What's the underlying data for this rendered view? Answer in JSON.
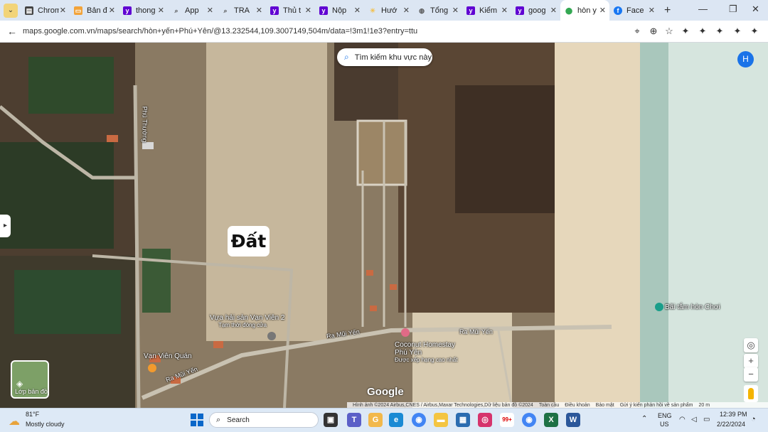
{
  "browser": {
    "tabs": [
      {
        "label": "Chrom",
        "icon": "document-icon",
        "color": "#444444"
      },
      {
        "label": "Bản đ",
        "icon": "folder-icon",
        "color": "#f2a33a"
      },
      {
        "label": "thong",
        "icon": "yahoo-icon",
        "color": "#6001d2"
      },
      {
        "label": "App",
        "icon": "search-icon",
        "color": "#555555"
      },
      {
        "label": "TRA",
        "icon": "search-icon",
        "color": "#555555"
      },
      {
        "label": "Thủ t",
        "icon": "yahoo-icon",
        "color": "#6001d2"
      },
      {
        "label": "Nộp",
        "icon": "yahoo-icon",
        "color": "#6001d2"
      },
      {
        "label": "Hướ",
        "icon": "sun-icon",
        "color": "#f2c14e"
      },
      {
        "label": "Tổng",
        "icon": "globe-icon",
        "color": "#555555"
      },
      {
        "label": "Kiểm",
        "icon": "yahoo-icon",
        "color": "#6001d2"
      },
      {
        "label": "goog",
        "icon": "yahoo-icon",
        "color": "#6001d2"
      },
      {
        "label": "hòn y",
        "icon": "maps-pin-icon",
        "color": "#34a853",
        "active": true
      },
      {
        "label": "Face",
        "icon": "facebook-icon",
        "color": "#1877f2"
      }
    ],
    "url": "maps.google.com.vn/maps/search/hòn+yến+Phú+Yên/@13.232544,109.3007149,504m/data=!3m1!1e3?entry=ttu"
  },
  "map": {
    "search_area_label": "Tìm kiếm khu vực này",
    "user_initial": "H",
    "annotation": "Đất",
    "places": {
      "vuaHaiSan": "Vựa hải sản Vạn Viên 2",
      "vuaHaiSanSub": "Tạm thời đóng cửa",
      "vanVienQuan": "Vạn Viên Quán",
      "coconut": "Coconut Homestay",
      "coconut2": "Phú Yên",
      "coconutSub": "Được xếp hạng cao nhất",
      "baiTam": "Bãi tắm hòn Chơi"
    },
    "roads": {
      "phuThuong": "Phú Thường",
      "raMuiYen1": "Ra Mũi Yến",
      "raMuiYen2": "Ra Mũi Yến",
      "raMuiYen3": "Ra Mũi Yến"
    },
    "layers_label": "Lớp bản đồ",
    "logo": "Google",
    "footer": [
      "Hình ảnh ©2024 Airbus,CNES / Airbus,Maxar Technologies,Dữ liệu bản đồ ©2024",
      "Toàn cầu",
      "Điều khoản",
      "Bảo mật",
      "Gửi ý kiến phản hồi về sản phẩm",
      "20 m"
    ]
  },
  "taskbar": {
    "weather_temp": "81°F",
    "weather_desc": "Mostly cloudy",
    "search_label": "Search",
    "lang1": "ENG",
    "lang2": "US",
    "time": "12:39 PM",
    "date": "2/22/2024",
    "badge": "99+"
  }
}
